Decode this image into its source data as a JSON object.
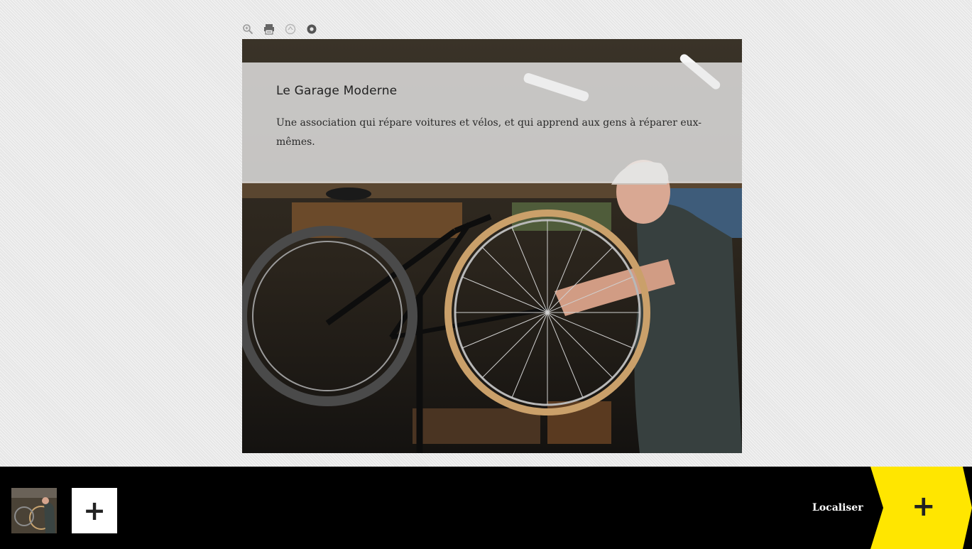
{
  "toolbar": {
    "icons": [
      "zoom-icon",
      "print-icon",
      "share-icon",
      "settings-icon"
    ]
  },
  "card": {
    "title": "Le Garage Moderne",
    "description": "Une association qui répare voitures et vélos, et qui apprend aux gens à réparer eux-mêmes."
  },
  "bottom_bar": {
    "add_label": "+",
    "localiser_label": "Localiser",
    "next_label": "+"
  },
  "colors": {
    "accent_yellow": "#ffe600",
    "bar_background": "#000000",
    "page_background": "#e6e6e6"
  }
}
